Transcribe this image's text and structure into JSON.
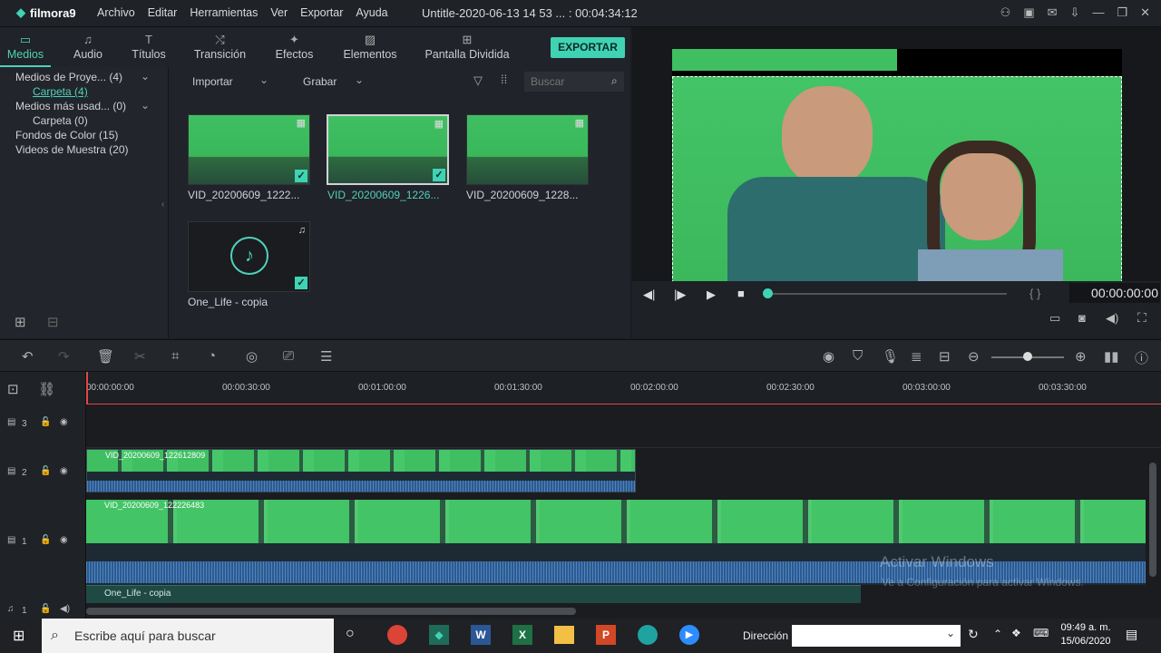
{
  "app": {
    "name": "filmora9",
    "title": "Untitle-2020-06-13 14 53 ... : 00:04:34:12"
  },
  "menu": [
    "Archivo",
    "Editar",
    "Herramientas",
    "Ver",
    "Exportar",
    "Ayuda"
  ],
  "tabs": [
    {
      "label": "Medios",
      "icon": "folder-icon"
    },
    {
      "label": "Audio",
      "icon": "music-note-icon"
    },
    {
      "label": "Títulos",
      "icon": "text-icon"
    },
    {
      "label": "Transición",
      "icon": "transition-icon"
    },
    {
      "label": "Efectos",
      "icon": "effects-icon"
    },
    {
      "label": "Elementos",
      "icon": "image-icon"
    },
    {
      "label": "Pantalla Dividida",
      "icon": "split-screen-icon"
    }
  ],
  "export_label": "EXPORTAR",
  "tree": [
    {
      "label": "Medios de Proye... (4)",
      "indent": false
    },
    {
      "label": "Carpeta (4)",
      "indent": true,
      "active": true
    },
    {
      "label": "Medios más usad... (0)",
      "indent": false
    },
    {
      "label": "Carpeta (0)",
      "indent": true
    },
    {
      "label": "Fondos de Color (15)",
      "indent": false
    },
    {
      "label": "Videos de Muestra (20)",
      "indent": false
    }
  ],
  "media_toolbar": {
    "import": "Importar",
    "record": "Grabar",
    "search_placeholder": "Buscar"
  },
  "media": [
    {
      "name": "VID_20200609_1222...",
      "type": "video",
      "selected": false
    },
    {
      "name": "VID_20200609_1226...",
      "type": "video",
      "selected": true
    },
    {
      "name": "VID_20200609_1228...",
      "type": "video",
      "selected": false
    },
    {
      "name": "One_Life - copia",
      "type": "audio",
      "selected": false
    }
  ],
  "preview": {
    "timecode": "00:00:00:00",
    "brackets": "{ }"
  },
  "ruler_ticks": [
    "00:00:00:00",
    "00:00:30:00",
    "00:01:00:00",
    "00:01:30:00",
    "00:02:00:00",
    "00:02:30:00",
    "00:03:00:00",
    "00:03:30:00"
  ],
  "tracks": [
    {
      "id": "3",
      "kind": "video"
    },
    {
      "id": "2",
      "kind": "video",
      "clip": "VID_20200609_122612809"
    },
    {
      "id": "1",
      "kind": "video",
      "clip": "VID_20200609_122226483"
    },
    {
      "id": "1",
      "kind": "audio",
      "clip": "One_Life - copia"
    }
  ],
  "watermark": {
    "line1": "Activar Windows",
    "line2": "Ve a Configuración para activar Windows."
  },
  "taskbar": {
    "search": "Escribe aquí para buscar",
    "address_label": "Dirección",
    "time": "09:49 a. m.",
    "date": "15/06/2020"
  },
  "colors": {
    "accent": "#3fd3b4",
    "playhead": "#e04848"
  }
}
